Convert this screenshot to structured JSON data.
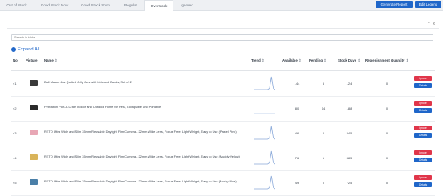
{
  "tabs": [
    {
      "label": "Out of Stock"
    },
    {
      "label": "Good Stock Now"
    },
    {
      "label": "Good Stock Soon"
    },
    {
      "label": "Regular"
    },
    {
      "label": "Overstock"
    },
    {
      "label": "Ignored"
    }
  ],
  "active_tab": "Overstock",
  "toolbar": {
    "generate_report": "Generate Report",
    "edit_legend": "Edit Legend"
  },
  "panel_icons": {
    "collapse": "^",
    "close": "x"
  },
  "search": {
    "placeholder": "Search in table"
  },
  "expand_all": {
    "icon": "+",
    "label": "Expand All"
  },
  "table": {
    "headers": {
      "no": "No",
      "picture": "Picture",
      "name": "Name",
      "trend": "Trend",
      "available": "Available",
      "pending": "Pending",
      "stock_days": "Stock Days",
      "replenishment": "Replenishment Quantity"
    },
    "sort_glyph": "⇕",
    "rows": [
      {
        "expander": "› 1",
        "name": "Ball Mason 4oz Quilted Jelly Jars with Lids and Bands, Set of 2",
        "available": "144",
        "pending": "5",
        "stock_days": "124",
        "replenishment": "0",
        "ignore": "Ignore",
        "details": "Details",
        "thumb_color": "#3a3a3a",
        "trend": [
          0,
          0,
          0,
          0,
          0,
          0,
          0,
          0,
          0.1,
          1,
          0.1,
          0
        ]
      },
      {
        "expander": "› 2",
        "name": "PetNation Port-A-Crate Indoor and Outdoor Home for Pets, Collapsible and Portable",
        "available": "80",
        "pending": "14",
        "stock_days": "188",
        "replenishment": "0",
        "ignore": "Ignore",
        "details": "Details",
        "thumb_color": "#2a2a2a",
        "trend": [
          0.05,
          0.05,
          0.05,
          0.05,
          0.05,
          0.05,
          0.05,
          0.05,
          0.05,
          0.05,
          0.05,
          0.05
        ]
      },
      {
        "expander": "› 3",
        "name": "RETO Ultra Wide and Slim 35mm Reusable Daylight Film Camera - 22mm Wide Lens, Focus Free, Light Weight, Easy to Use (Pastel Pink)",
        "available": "46",
        "pending": "0",
        "stock_days": "345",
        "replenishment": "0",
        "ignore": "Ignore",
        "details": "Details",
        "thumb_color": "#e8a7b5",
        "trend": [
          0,
          0,
          0,
          0,
          0,
          0,
          0,
          0,
          0.1,
          1,
          0.1,
          0
        ]
      },
      {
        "expander": "› 4",
        "name": "RETO Ultra Wide and Slim 35mm Reusable Daylight Film Camera - 22mm Wide Lens, Focus Free, Light Weight, Easy to Use (Muddy Yellow)",
        "available": "76",
        "pending": "1",
        "stock_days": "385",
        "replenishment": "0",
        "ignore": "Ignore",
        "details": "Details",
        "thumb_color": "#d9b45a",
        "trend": [
          0,
          0,
          0,
          0,
          0,
          0,
          0,
          0,
          0.1,
          1,
          0.1,
          0
        ]
      },
      {
        "expander": "› 5",
        "name": "RETO Ultra Wide and Slim 35mm Reusable Daylight Film Camera - 22mm Wide Lens, Focus Free, Light Weight, Easy to Use (Murky Blue)",
        "available": "49",
        "pending": "0",
        "stock_days": "725",
        "replenishment": "0",
        "ignore": "Ignore",
        "details": "Details",
        "thumb_color": "#4a7fa8",
        "trend": [
          0,
          0,
          0,
          0,
          0,
          0,
          0,
          0,
          0.1,
          1,
          0.1,
          0
        ]
      }
    ]
  },
  "colors": {
    "primary": "#1f66c9",
    "danger": "#e0364a",
    "spark": "#8aa9d9"
  }
}
